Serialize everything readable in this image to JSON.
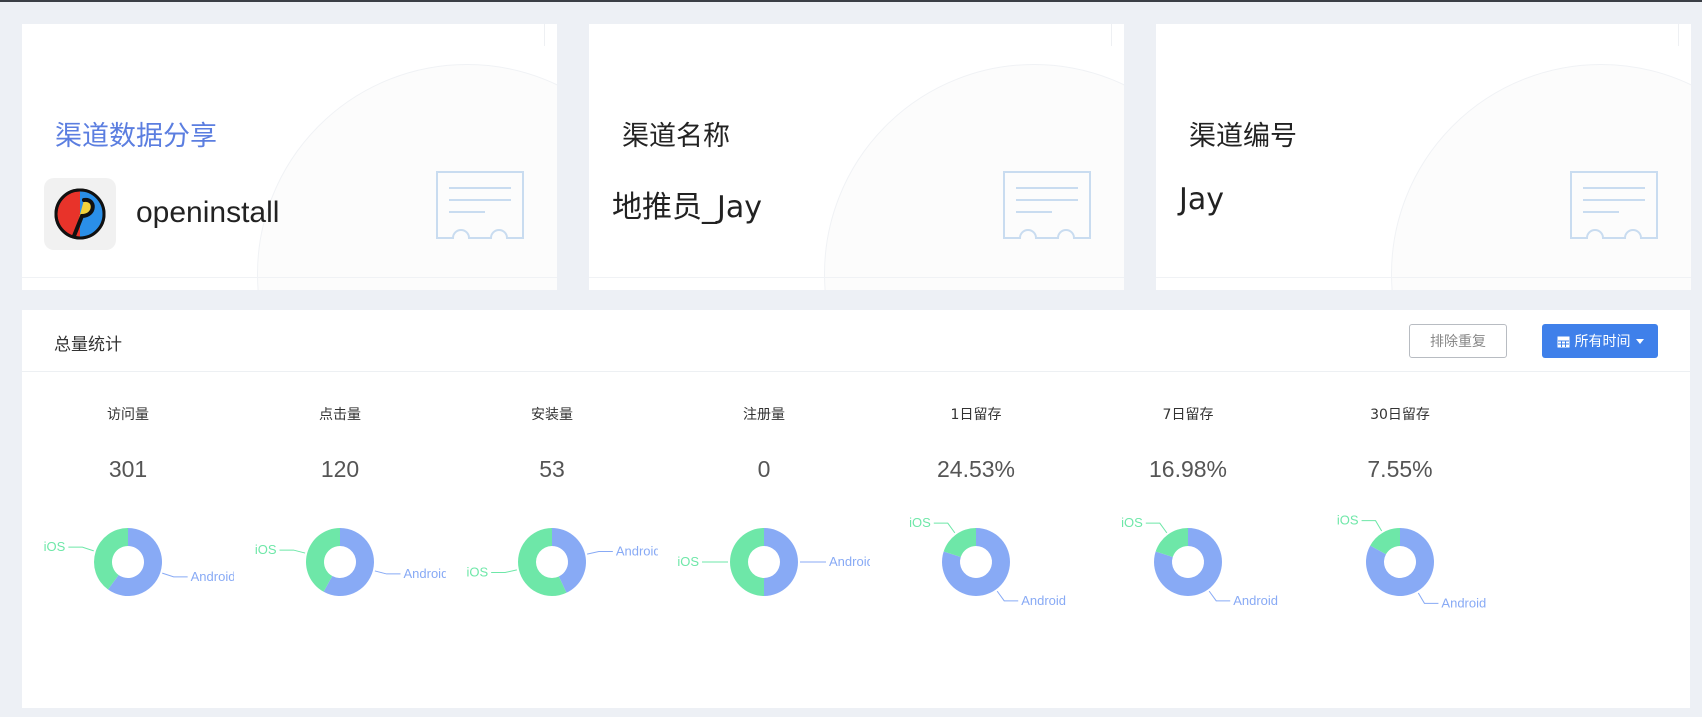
{
  "cards": [
    {
      "title": "渠道数据分享",
      "app_name": "openinstall"
    },
    {
      "title": "渠道名称",
      "value": "地推员_Jay"
    },
    {
      "title": "渠道编号",
      "value": "Jay"
    }
  ],
  "panel": {
    "title": "总量统计",
    "dedupe_button": "排除重复",
    "time_button": "所有时间",
    "time_icon": "calendar-icon",
    "caret_icon": "caret-down-icon"
  },
  "colors": {
    "ios": "#6ee7a8",
    "android": "#88aaf5",
    "accent": "#5b7ee0",
    "button": "#3f80ea"
  },
  "stats": [
    {
      "label": "访问量",
      "value": "301",
      "ios_label": "iOS",
      "android_label": "Android",
      "ios_share": 0.4
    },
    {
      "label": "点击量",
      "value": "120",
      "ios_label": "iOS",
      "android_label": "Android",
      "ios_share": 0.42
    },
    {
      "label": "安装量",
      "value": "53",
      "ios_label": "iOS",
      "android_label": "Android",
      "ios_share": 0.57
    },
    {
      "label": "注册量",
      "value": "0",
      "ios_label": "iOS",
      "android_label": "Android",
      "ios_share": 0.5
    },
    {
      "label": "1日留存",
      "value": "24.53%",
      "ios_label": "iOS",
      "android_label": "Android",
      "ios_share": 0.2
    },
    {
      "label": "7日留存",
      "value": "16.98%",
      "ios_label": "iOS",
      "android_label": "Android",
      "ios_share": 0.2
    },
    {
      "label": "30日留存",
      "value": "7.55%",
      "ios_label": "iOS",
      "android_label": "Android",
      "ios_share": 0.17
    }
  ]
}
